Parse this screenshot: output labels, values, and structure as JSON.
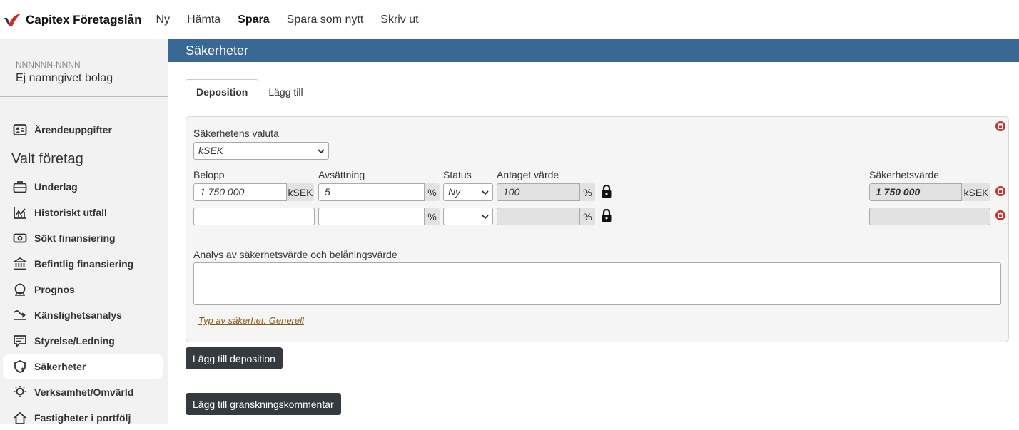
{
  "app": {
    "brand": "Capitex Företagslån"
  },
  "topnav": [
    "Ny",
    "Hämta",
    "Spara",
    "Spara som nytt",
    "Skriv ut"
  ],
  "company": {
    "org_no": "NNNNNN-NNNN",
    "name": "Ej namngivet bolag"
  },
  "sidebar": {
    "top_item": "Ärendeuppgifter",
    "section": "Valt företag",
    "items": [
      "Underlag",
      "Historiskt utfall",
      "Sökt finansiering",
      "Befintlig finansiering",
      "Prognos",
      "Känslighetsanalys",
      "Styrelse/Ledning",
      "Säkerheter",
      "Verksamhet/Omvärld",
      "Fastigheter i portfölj"
    ],
    "active": "Säkerheter"
  },
  "page": {
    "title": "Säkerheter"
  },
  "tabs": [
    "Deposition",
    "Lägg till"
  ],
  "form": {
    "currency_label": "Säkerhetens valuta",
    "currency_value": "kSEK",
    "col_amount": "Belopp",
    "col_provision": "Avsättning",
    "col_status": "Status",
    "col_assumed": "Antaget värde",
    "col_security_value": "Säkerhetsvärde",
    "unit_ksek": "kSEK",
    "unit_pct": "%",
    "rows": [
      {
        "amount": "1 750 000",
        "provision": "5",
        "status": "Ny",
        "assumed": "100",
        "security_value": "1 750 000"
      },
      {
        "amount": "",
        "provision": "",
        "status": "",
        "assumed": "",
        "security_value": ""
      }
    ],
    "analysis_label": "Analys av säkerhetsvärde och belåningsvärde",
    "type_link": "Typ av säkerhet: Generell"
  },
  "buttons": {
    "add_deposit": "Lägg till deposition",
    "add_comment": "Lägg till granskningskommentar"
  },
  "colors": {
    "header": "#3a6894",
    "button": "#343a40",
    "danger": "#c8322b"
  }
}
